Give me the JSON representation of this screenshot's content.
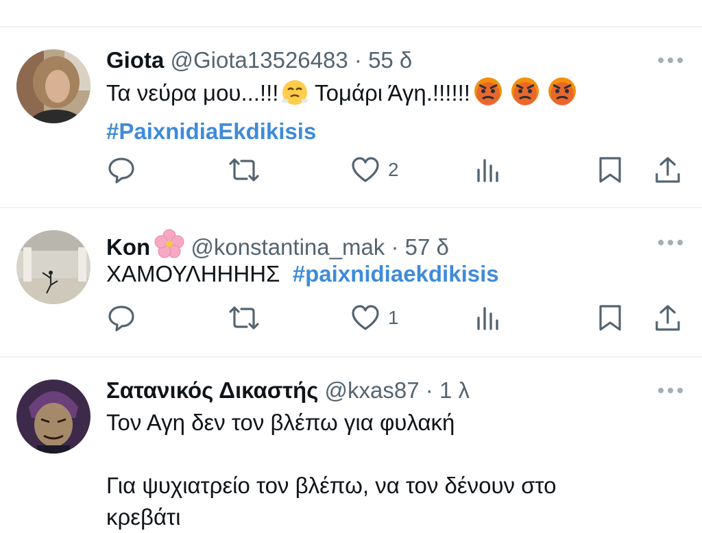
{
  "colors": {
    "link": "#3f8bd9",
    "muted": "#536471",
    "text": "#0f1419",
    "divider": "#eff3f4"
  },
  "tweets": [
    {
      "name": "Giota",
      "handle": "@Giota13526483",
      "separator": "·",
      "time": "55 δ",
      "text_parts": [
        "Τα νεύρα μου...!!!",
        " Τομάρι Άγη.!!!!!!"
      ],
      "emojis": [
        "huffing-face-emoji",
        "angry-face-emoji",
        "angry-face-emoji",
        "angry-face-emoji"
      ],
      "hashtag": "#PaixnidiaEkdikisis",
      "likes": "2",
      "avatar": "woman-curly-hair-photo"
    },
    {
      "name": "Kon",
      "name_emoji": "cherry-blossom-emoji",
      "handle": "@konstantina_mak",
      "separator": "·",
      "time": "57 δ",
      "text": "ΧΑΜΟΥΛΗΗΗΗΣ",
      "hashtag": "#paixnidiaekdikisis",
      "likes": "1",
      "avatar": "dancer-studio-photo"
    },
    {
      "name": "Σατανικός Δικαστής",
      "handle": "@kxas87",
      "separator": "·",
      "time": "1 λ",
      "line1": "Τον Αγη δεν τον βλέπω για φυλακή",
      "line2": "Για ψυχιατρείο τον βλέπω, να τον δένουν στο",
      "line3": "κρεβάτι",
      "avatar": "cartoon-judge-avatar"
    }
  ]
}
